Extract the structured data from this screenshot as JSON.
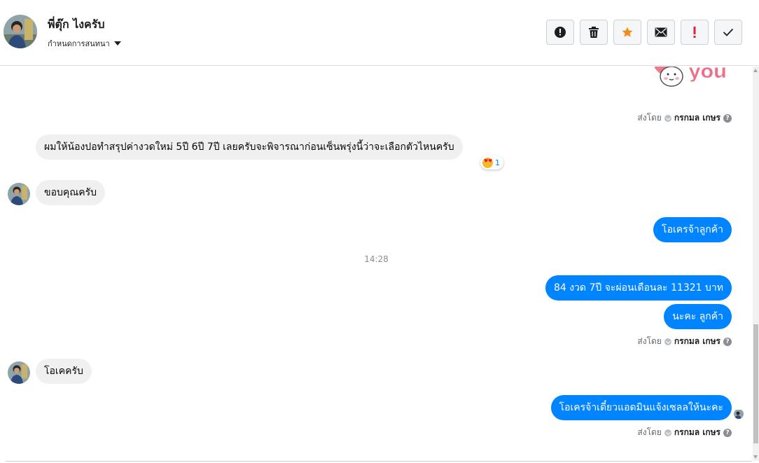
{
  "header": {
    "contact_name": "พี่ตุ๊ก ไงครับ",
    "conversation_menu_label": "กำหนดการสนทนา",
    "actions": [
      {
        "icon": "alert-circle-icon"
      },
      {
        "icon": "trash-icon"
      },
      {
        "icon": "star-icon",
        "color": "#f28b1c"
      },
      {
        "icon": "envelope-icon"
      },
      {
        "icon": "exclamation-icon",
        "color": "#e41e3f"
      },
      {
        "icon": "check-icon"
      }
    ]
  },
  "thread": {
    "sticker_text": "you",
    "sent_by_prefix": "ส่งโดย",
    "sent_by_name": "กรกมล เกษร",
    "messages": [
      {
        "direction": "in",
        "text": "ผมให้น้องปอทำสรุปค่างวดใหม่  5ปี 6ปี 7ปี  เลยครับจะพิจารณาก่อนเซ็นพรุ่งนี้ว่าจะเลือกตัวไหนครับ",
        "reaction_count": "1"
      },
      {
        "direction": "in",
        "text": "ขอบคุณครับ"
      },
      {
        "direction": "out",
        "text": "โอเครจ้าลูกค้า"
      },
      {
        "direction": "out",
        "text": "84 งวด 7ปี จะผ่อนเดือนละ 11321 บาท"
      },
      {
        "direction": "out",
        "text": "นะคะ ลูกค้า"
      },
      {
        "direction": "in",
        "text": "โอเคครับ"
      },
      {
        "direction": "out",
        "text": "โอเครจ้าเดี๋ยวแอดมินแจ้งเซลลให้นะคะ"
      }
    ],
    "timestamp": "14:28"
  }
}
